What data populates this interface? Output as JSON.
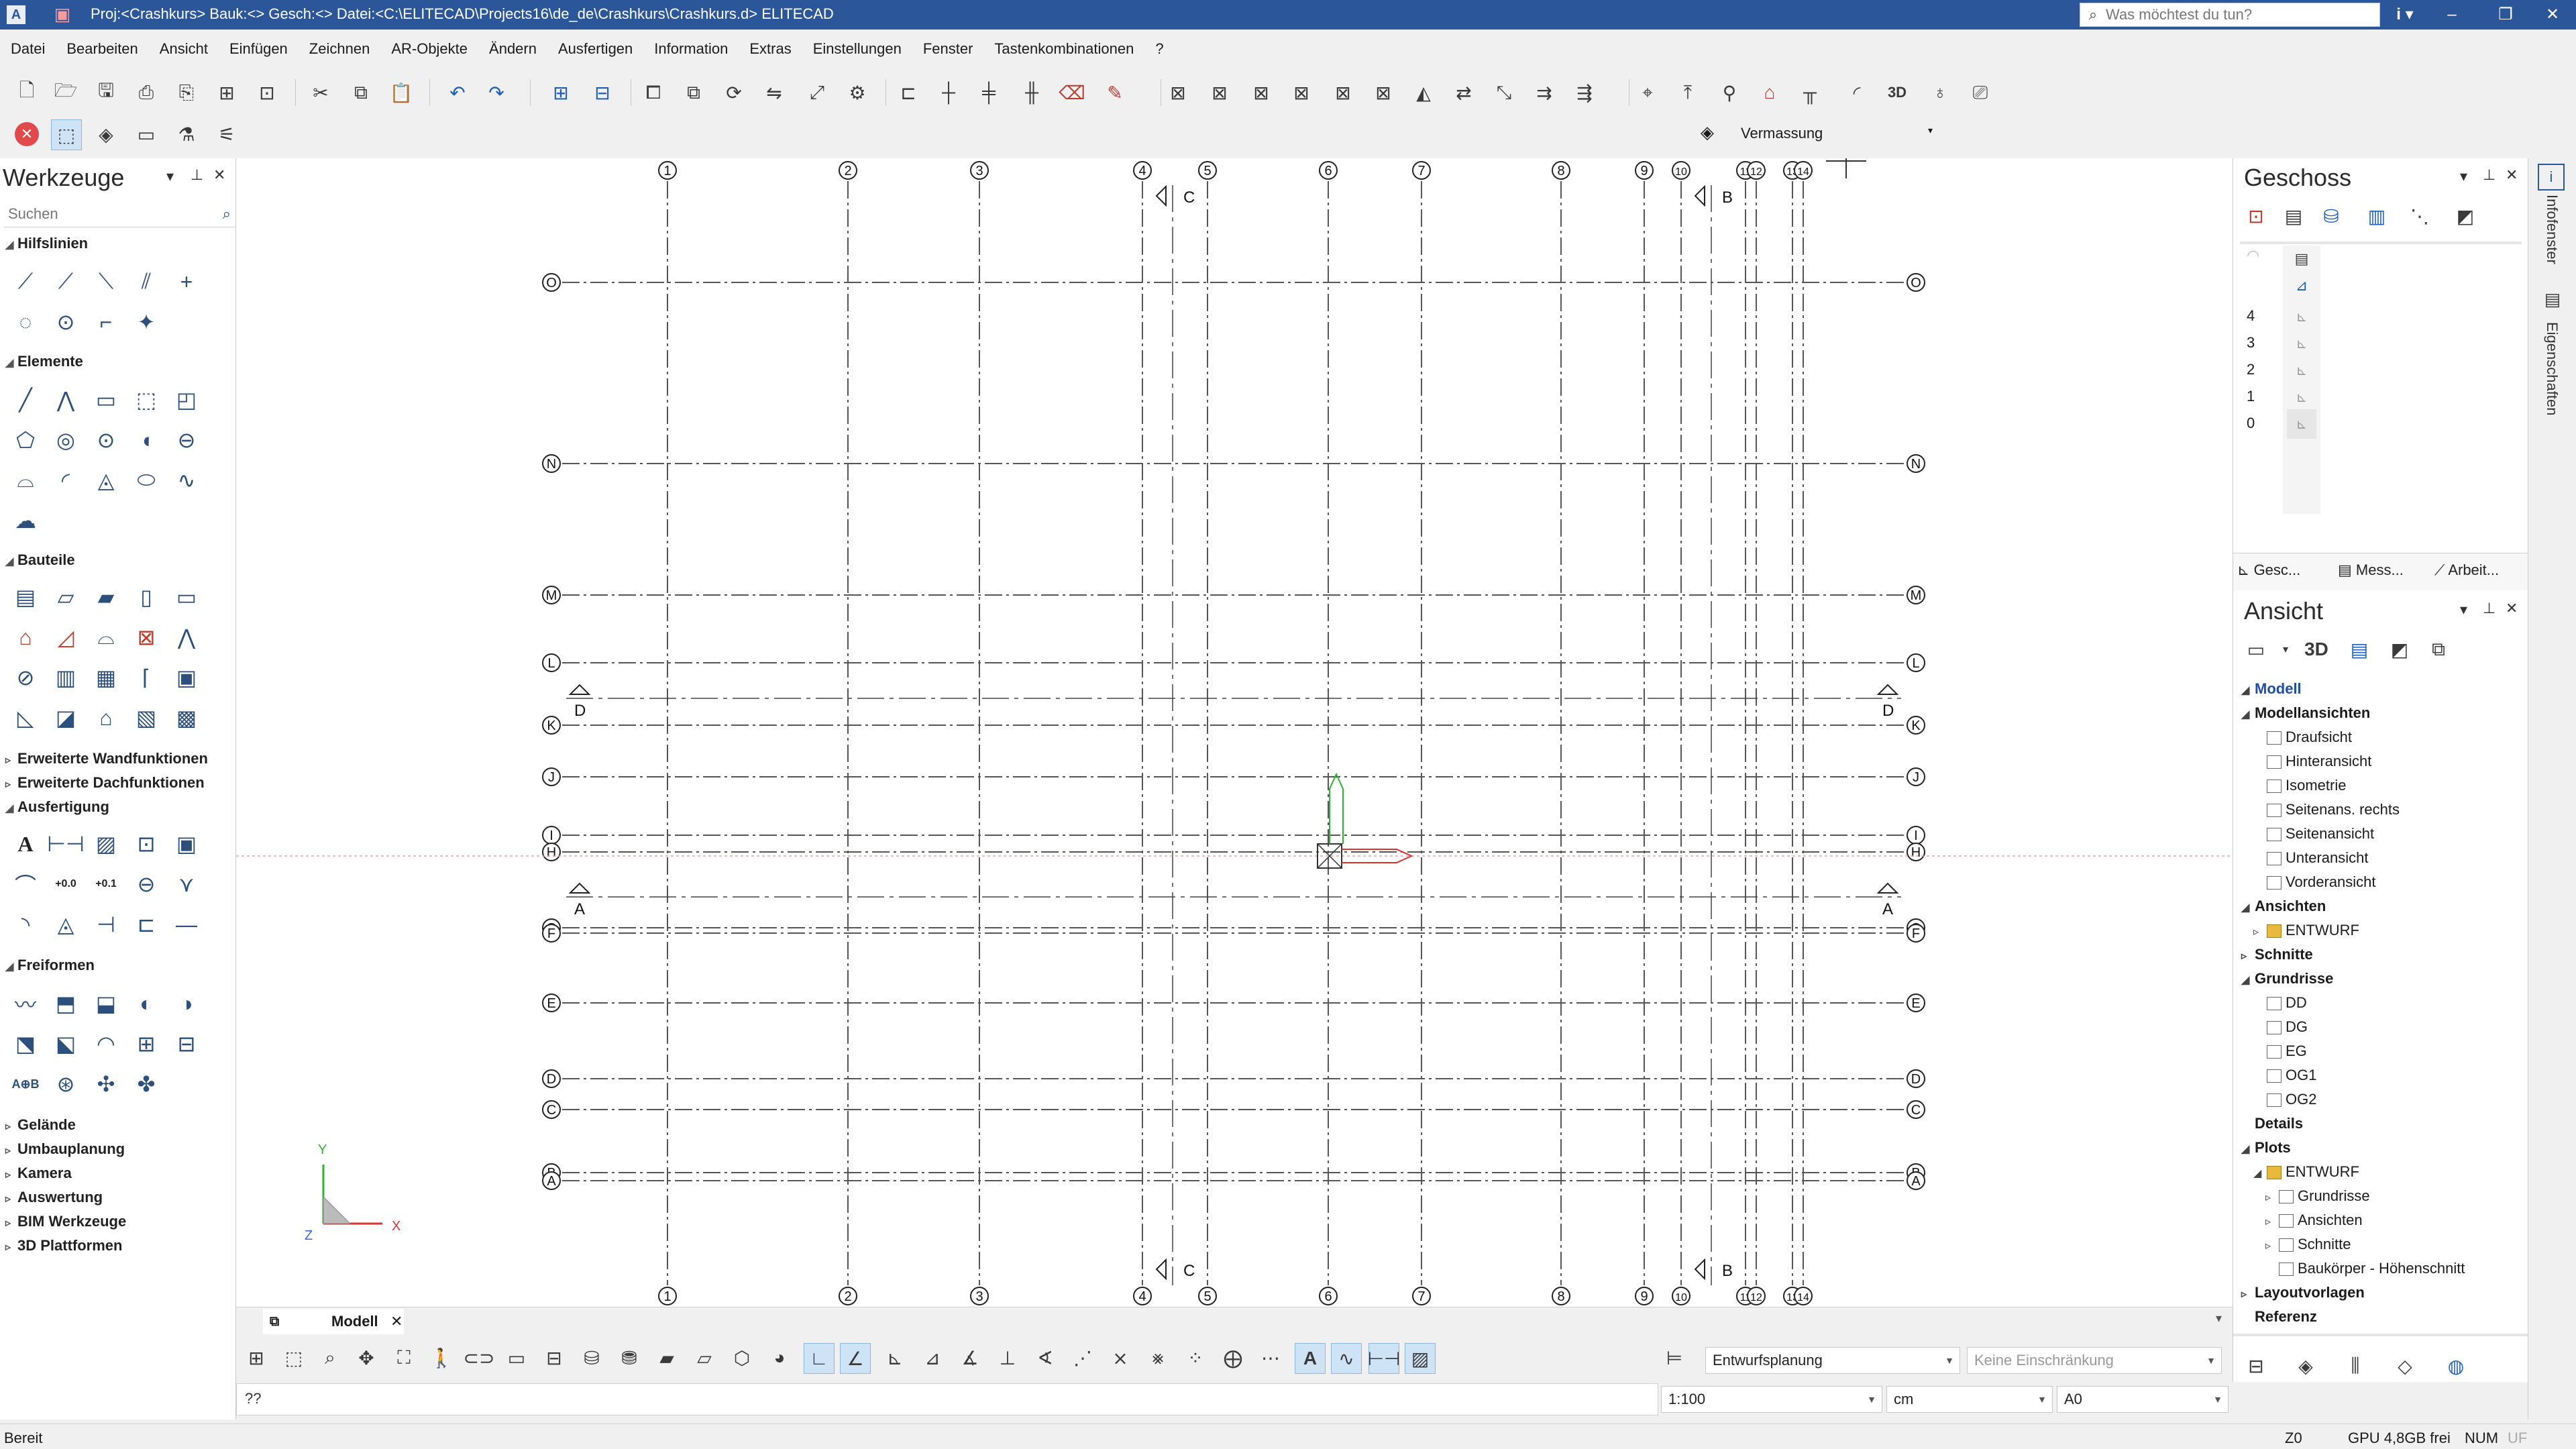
{
  "titlebar": {
    "title": "Proj:<Crashkurs> Bauk:<> Gesch:<> Datei:<C:\\ELITECAD\\Projects16\\de_de\\Crashkurs\\Crashkurs.d> ELITECAD",
    "app_icon": "A",
    "search_placeholder": "Was möchtest du tun?",
    "info_glyph": "i",
    "minimize": "–",
    "restore": "❐",
    "close": "✕"
  },
  "menu": [
    "Datei",
    "Bearbeiten",
    "Ansicht",
    "Einfügen",
    "Zeichnen",
    "AR-Objekte",
    "Ändern",
    "Ausfertigen",
    "Information",
    "Extras",
    "Einstellungen",
    "Fenster",
    "Tastenkombinationen",
    "?"
  ],
  "toolbar": {
    "layer_combo": "Vermassung"
  },
  "tools_panel": {
    "title": "Werkzeuge",
    "search_placeholder": "Suchen",
    "sections": [
      "Hilfslinien",
      "Elemente",
      "Bauteile",
      "Erweiterte Wandfunktionen",
      "Erweiterte Dachfunktionen",
      "Ausfertigung",
      "Freiformen",
      "Gelände",
      "Umbauplanung",
      "Kamera",
      "Auswertung",
      "BIM Werkzeuge",
      "3D Plattformen"
    ],
    "dim_label_1": "+0.0",
    "dim_label_2": "+0.1",
    "text_tool": "A"
  },
  "canvas": {
    "axis_numbers": [
      "1",
      "2",
      "3",
      "4",
      "5",
      "6",
      "7",
      "8",
      "9",
      "10",
      "11",
      "12",
      "13",
      "14"
    ],
    "axis_letters": [
      "O",
      "N",
      "M",
      "L",
      "K",
      "J",
      "I",
      "H",
      "G",
      "F",
      "E",
      "D",
      "C",
      "B",
      "A"
    ],
    "section_labels": [
      "C",
      "B",
      "D",
      "A"
    ],
    "coord_axes": {
      "x": "X",
      "y": "Y",
      "z": "Z"
    }
  },
  "doc_tab": {
    "label": "Modell"
  },
  "bottombar": {
    "phase_combo": "Entwurfsplanung",
    "restriction_combo": "Keine Einschränkung",
    "scale_combo": "1:100",
    "unit_combo": "cm",
    "paper_combo": "A0",
    "command_text": "??"
  },
  "status": {
    "left": "Bereit",
    "z": "Z0",
    "gpu": "GPU 4,8GB frei",
    "num": "NUM",
    "uf": "UF"
  },
  "geschoss": {
    "title": "Geschoss",
    "floors": [
      "4",
      "3",
      "2",
      "1",
      "0"
    ],
    "tabs": [
      "Gesc...",
      "Mess...",
      "Arbeit..."
    ]
  },
  "ansicht": {
    "title": "Ansicht",
    "threed_label": "3D",
    "tree": [
      {
        "label": "Modell",
        "level": 0,
        "bold": true,
        "open": true,
        "blue": true
      },
      {
        "label": "Modellansichten",
        "level": 0,
        "bold": true,
        "open": true
      },
      {
        "label": "Draufsicht",
        "level": 1
      },
      {
        "label": "Hinteransicht",
        "level": 1
      },
      {
        "label": "Isometrie",
        "level": 1
      },
      {
        "label": "Seitenans. rechts",
        "level": 1
      },
      {
        "label": "Seitenansicht",
        "level": 1
      },
      {
        "label": "Unteransicht",
        "level": 1
      },
      {
        "label": "Vorderansicht",
        "level": 1
      },
      {
        "label": "Ansichten",
        "level": 0,
        "bold": true,
        "open": true
      },
      {
        "label": "ENTWURF",
        "level": 1,
        "folder": true,
        "closed": true
      },
      {
        "label": "Schnitte",
        "level": 0,
        "bold": true,
        "closed": true
      },
      {
        "label": "Grundrisse",
        "level": 0,
        "bold": true,
        "open": true
      },
      {
        "label": "DD",
        "level": 1
      },
      {
        "label": "DG",
        "level": 1
      },
      {
        "label": "EG",
        "level": 1
      },
      {
        "label": "OG1",
        "level": 1
      },
      {
        "label": "OG2",
        "level": 1
      },
      {
        "label": "Details",
        "level": 0,
        "bold": true
      },
      {
        "label": "Plots",
        "level": 0,
        "bold": true,
        "open": true
      },
      {
        "label": "ENTWURF",
        "level": 1,
        "folder": true,
        "open": true
      },
      {
        "label": "Grundrisse",
        "level": 2,
        "closed": true
      },
      {
        "label": "Ansichten",
        "level": 2,
        "closed": true
      },
      {
        "label": "Schnitte",
        "level": 2,
        "closed": true
      },
      {
        "label": "Baukörper - Höhenschnitt",
        "level": 2
      },
      {
        "label": "Layoutvorlagen",
        "level": 0,
        "bold": true,
        "closed": true
      },
      {
        "label": "Referenz",
        "level": 0,
        "bold": true
      }
    ]
  },
  "side_strip": {
    "infofenster": "Infofenster",
    "eigenschaften": "Eigenschaften"
  }
}
